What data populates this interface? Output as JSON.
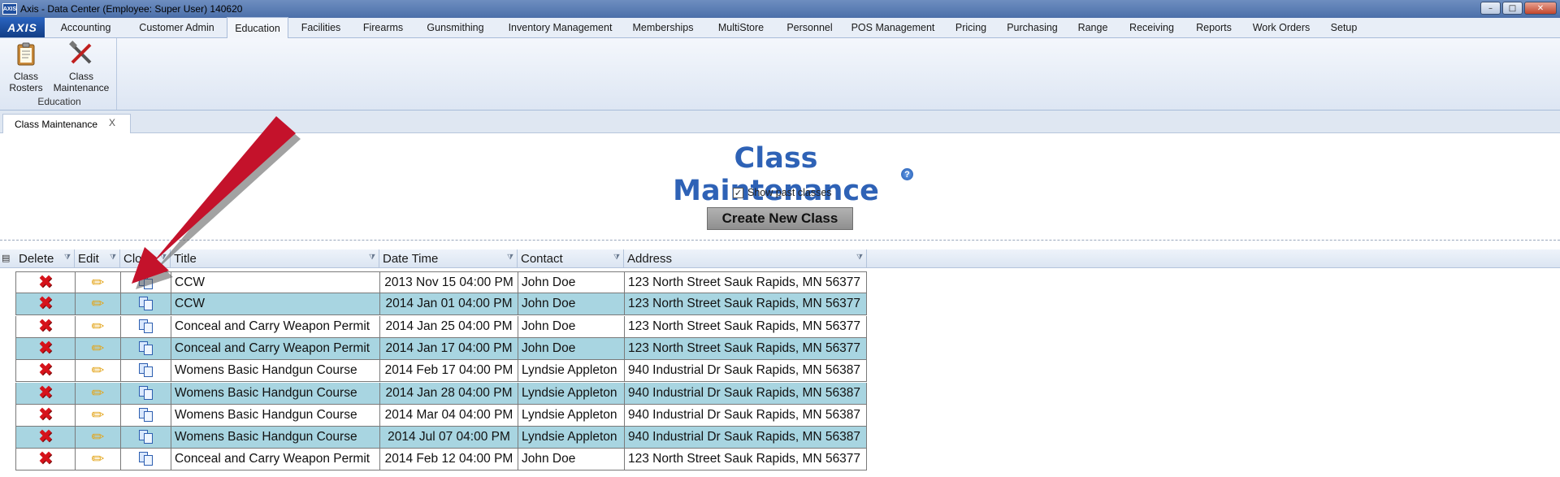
{
  "window": {
    "title": "Axis - Data Center  (Employee: Super User) 140620",
    "app_icon": "AXIS"
  },
  "ribbon": {
    "logo": "AXIS",
    "tabs": [
      "Accounting",
      "Customer Admin",
      "Education",
      "Facilities",
      "Firearms",
      "Gunsmithing",
      "Inventory Management",
      "Memberships",
      "MultiStore",
      "Personnel",
      "POS Management",
      "Pricing",
      "Purchasing",
      "Range",
      "Receiving",
      "Reports",
      "Work Orders",
      "Setup"
    ],
    "active_tab": "Education",
    "group": {
      "label": "Education",
      "buttons": [
        {
          "line1": "Class",
          "line2": "Rosters",
          "icon": "clipboard-icon"
        },
        {
          "line1": "Class",
          "line2": "Maintenance",
          "icon": "tools-icon"
        }
      ]
    }
  },
  "doc_tab": {
    "label": "Class Maintenance",
    "close": "X"
  },
  "page": {
    "title": "Class Maintenance",
    "help": "?",
    "show_past_label": "Show past classes",
    "show_past_checked": true,
    "create_button": "Create New Class"
  },
  "grid": {
    "columns": [
      "Delete",
      "Edit",
      "Clone",
      "Title",
      "Date Time",
      "Contact",
      "Address"
    ],
    "rows": [
      {
        "title": "CCW",
        "datetime": "2013 Nov 15 04:00 PM",
        "contact": "John Doe",
        "address": "123 North Street Sauk Rapids, MN 56377"
      },
      {
        "title": "CCW",
        "datetime": "2014 Jan 01 04:00 PM",
        "contact": "John Doe",
        "address": "123 North Street Sauk Rapids, MN 56377"
      },
      {
        "title": "Conceal and Carry Weapon Permit",
        "datetime": "2014 Jan 25 04:00 PM",
        "contact": "John Doe",
        "address": "123 North Street Sauk Rapids, MN 56377"
      },
      {
        "title": "Conceal and Carry Weapon Permit",
        "datetime": "2014 Jan 17 04:00 PM",
        "contact": "John Doe",
        "address": "123 North Street Sauk Rapids, MN 56377"
      },
      {
        "title": "Womens Basic Handgun Course",
        "datetime": "2014 Feb 17 04:00 PM",
        "contact": "Lyndsie Appleton",
        "address": "940 Industrial Dr Sauk Rapids, MN 56387"
      },
      {
        "title": "Womens Basic Handgun Course",
        "datetime": "2014 Jan 28 04:00 PM",
        "contact": "Lyndsie Appleton",
        "address": "940 Industrial Dr Sauk Rapids, MN 56387"
      },
      {
        "title": "Womens Basic Handgun Course",
        "datetime": "2014 Mar 04 04:00 PM",
        "contact": "Lyndsie Appleton",
        "address": "940 Industrial Dr Sauk Rapids, MN 56387"
      },
      {
        "title": "Womens Basic Handgun Course",
        "datetime": "2014 Jul 07 04:00 PM",
        "contact": "Lyndsie Appleton",
        "address": "940 Industrial Dr Sauk Rapids, MN 56387"
      },
      {
        "title": "Conceal and Carry Weapon Permit",
        "datetime": "2014 Feb 12 04:00 PM",
        "contact": "John Doe",
        "address": "123 North Street Sauk Rapids, MN 56377"
      }
    ]
  },
  "colors": {
    "title_blue": "#2e62b6",
    "row_alt": "#a8d5e1",
    "delete_red": "#d6131b",
    "arrow_red": "#c4122b"
  }
}
